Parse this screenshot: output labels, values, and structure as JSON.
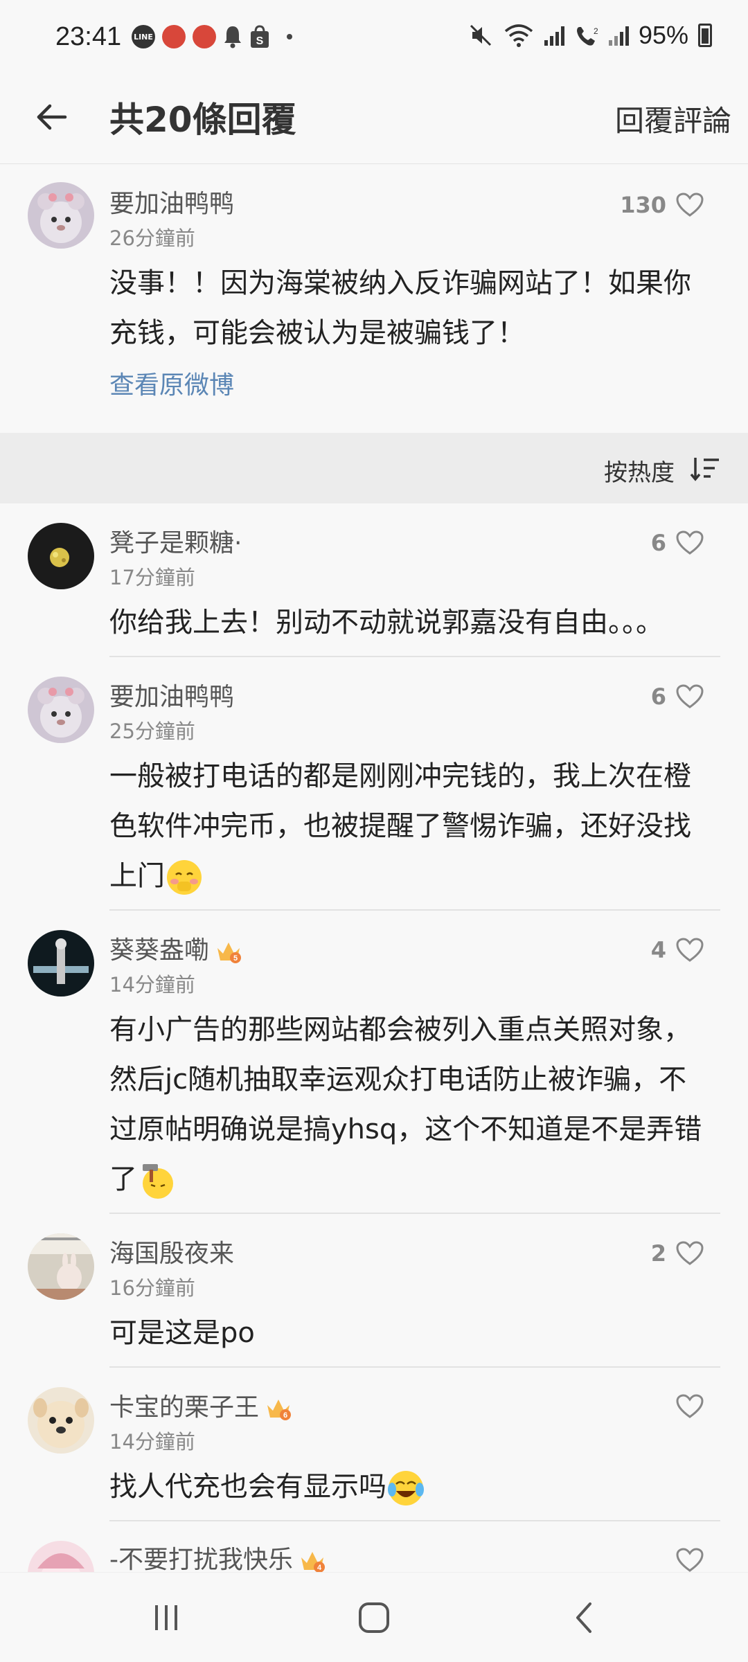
{
  "status": {
    "time": "23:41",
    "battery": "95%"
  },
  "header": {
    "title": "共20條回覆",
    "action": "回覆評論"
  },
  "main_post": {
    "username": "要加油鸭鸭",
    "time": "26分鐘前",
    "likes": "130",
    "text_line1": "没事！！因为海棠被纳入反诈骗网站了！如果你",
    "text_line2": "充钱，可能会被认为是被骗钱了！",
    "link": "查看原微博"
  },
  "sort": {
    "label": "按热度"
  },
  "comments": [
    {
      "username": "凳子是颗糖·",
      "time": "17分鐘前",
      "likes": "6",
      "lines": [
        "你给我上去！别动不动就说郭嘉没有自由。。。"
      ]
    },
    {
      "username": "要加油鸭鸭",
      "time": "25分鐘前",
      "likes": "6",
      "lines": [
        "一般被打电话的都是刚刚冲完钱的，我上次在橙",
        "色软件冲完币，也被提醒了警惕诈骗，还好没找",
        "上门"
      ]
    },
    {
      "username": "葵葵盎嘞",
      "time": "14分鐘前",
      "likes": "4",
      "badge_level": "5",
      "lines": [
        "有小广告的那些网站都会被列入重点关照对象，",
        "然后jc随机抽取幸运观众打电话防止被诈骗，不",
        "过原帖明确说是搞yhsq，这个不知道是不是弄错",
        "了"
      ]
    },
    {
      "username": "海国殷夜来",
      "time": "16分鐘前",
      "likes": "2",
      "lines": [
        "可是这是po"
      ]
    },
    {
      "username": "卡宝的栗子王",
      "time": "14分鐘前",
      "likes": "",
      "badge_level": "6",
      "lines": [
        "找人代充也会有显示吗"
      ]
    },
    {
      "username": "-不要打扰我快乐",
      "time": "",
      "likes": "",
      "badge_level": "4",
      "lines": []
    }
  ]
}
